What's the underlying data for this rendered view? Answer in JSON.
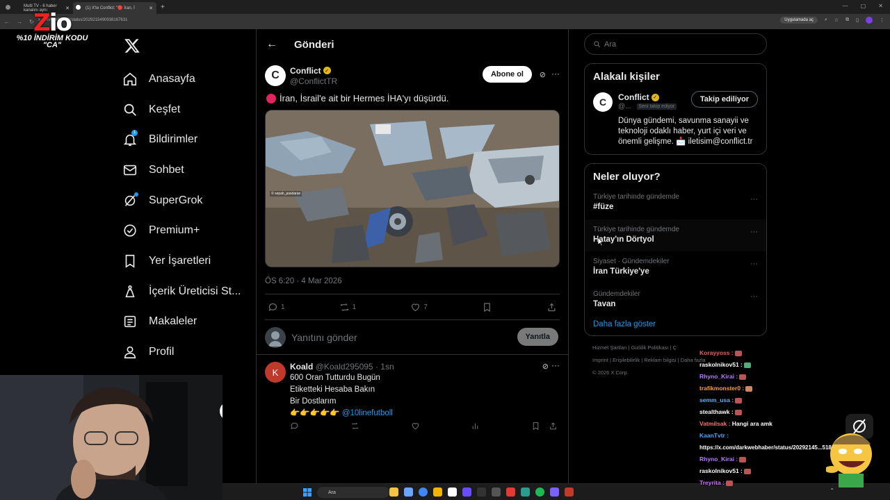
{
  "browser": {
    "tabs": [
      {
        "title": "Multi TV - 6 haber kanalını aynı"
      },
      {
        "title": "(1) X'te Conflict: \"🔴 İran, İ"
      }
    ],
    "url": "x.com/ConflictTR/status/2029215490938167631",
    "app_button": "Uygulamada aç"
  },
  "overlay": {
    "logo_part1": "Z",
    "logo_part2": "io",
    "promo_line1": "%10 İNDİRİM KODU",
    "promo_line2": "\"CA\""
  },
  "nav": {
    "items": [
      {
        "label": "Anasayfa",
        "icon": "home-icon"
      },
      {
        "label": "Keşfet",
        "icon": "search-icon"
      },
      {
        "label": "Bildirimler",
        "icon": "bell-icon",
        "badge": "1"
      },
      {
        "label": "Sohbet",
        "icon": "mail-icon"
      },
      {
        "label": "SuperGrok",
        "icon": "grok-icon"
      },
      {
        "label": "Premium+",
        "icon": "verified-icon"
      },
      {
        "label": "Yer İşaretleri",
        "icon": "bookmark-icon"
      },
      {
        "label": "İçerik Üreticisi St...",
        "icon": "flask-icon"
      },
      {
        "label": "Makaleler",
        "icon": "article-icon"
      },
      {
        "label": "Profil",
        "icon": "person-icon"
      }
    ]
  },
  "post": {
    "header_title": "Gönderi",
    "author_name": "Conflict",
    "author_handle": "@ConflictTR",
    "avatar_letter": "C",
    "follow_label": "Abone ol",
    "text": "İran, İsrail'e ait bir Hermes İHA'yı düşürdü.",
    "media_watermark": "© sepah_pasdaran",
    "timestamp": "ÖS 6:20 · 4 Mar 2026",
    "reply_count": "1",
    "repost_count": "1",
    "like_count": "7",
    "reply_placeholder": "Yanıtını gönder",
    "reply_button": "Yanıtla"
  },
  "comment": {
    "name": "Koald",
    "handle_time": "@Koald295095 · 1sn",
    "avatar_letter": "K",
    "line1": "600 Oran Tutturdu Bugün",
    "line2": "Etiketteki Hesaba Bakın",
    "line3": "Bir Dostlarım",
    "emoji": "👉👉👉👉👉",
    "link": "@10linefutboll"
  },
  "right": {
    "search_placeholder": "Ara",
    "related_title": "Alakalı kişiler",
    "related": {
      "name": "Conflict",
      "handle": "@...",
      "follows_you": "Seni takip ediyor",
      "button": "Takip ediliyor",
      "bio": "Dünya gündemi, savunma sanayii ve teknoloji odaklı haber, yurt içi veri ve önemli gelişme. 📩 iletisim@conflict.tr",
      "avatar_letter": "C"
    },
    "trends_title": "Neler oluyor?",
    "trends": [
      {
        "context": "Türkiye tarihinde gündemde",
        "name": "#füze"
      },
      {
        "context": "Türkiye tarihinde gündemde",
        "name": "Hatay'ın Dörtyol"
      },
      {
        "context": "Siyaset · Gündemdekiler",
        "name": "İran Türkiye'ye"
      },
      {
        "context": "Gündemdekiler",
        "name": "Tavan"
      }
    ],
    "show_more": "Daha fazla göster",
    "footer_line1": "Hizmet Şartları  |  Gizlilik Politikası  |  Ç",
    "footer_line2": "Imprint  |  Erişilebilirlik  |  Reklam bilgisi  |  Daha fazla",
    "footer_line3": "© 2026 X Corp."
  },
  "chat": [
    {
      "user": "Korayyoss :",
      "msg": "",
      "color": "#e85d5d"
    },
    {
      "user": "raskolnikov51 :",
      "msg": "",
      "color": "#ffffff"
    },
    {
      "user": "Rhyno_Kirai :",
      "msg": "",
      "color": "#b57bff"
    },
    {
      "user": "trafikmonster0 :",
      "msg": "",
      "color": "#ff9f2e"
    },
    {
      "user": "semm_usa :",
      "msg": "",
      "color": "#5ab0ff"
    },
    {
      "user": "stealthawk :",
      "msg": "",
      "color": "#ffffff"
    },
    {
      "user": "Vatmilsak :",
      "msg": "Hangi ara amk",
      "color": "#ff6b6b"
    },
    {
      "user": "KaanTvtr :",
      "msg": "",
      "color": "#4aa3ff"
    },
    {
      "user": "",
      "msg": "https://x.com/darkwebhaber/status/20292145...518017",
      "color": "#ffffff"
    },
    {
      "user": "Rhyno_Kirai :",
      "msg": "",
      "color": "#b57bff"
    },
    {
      "user": "raskolnikov51 :",
      "msg": "",
      "color": "#ffffff"
    },
    {
      "user": "Treyrita :",
      "msg": "",
      "color": "#d46bff"
    }
  ],
  "taskbar": {
    "search": "Ara"
  },
  "colors": {
    "accent": "#1d9bf0",
    "background": "#000000",
    "border": "#2f3336",
    "muted": "#71767b"
  }
}
